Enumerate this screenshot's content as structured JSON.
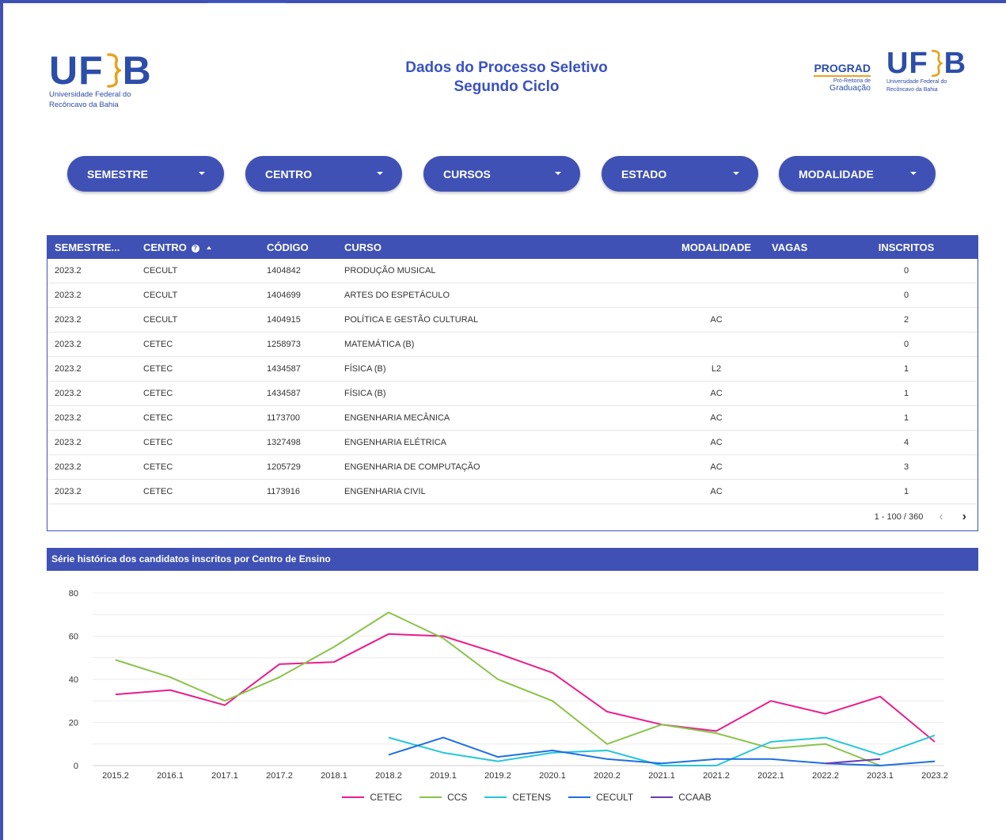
{
  "header": {
    "title_line1": "Dados do Processo Seletivo",
    "title_line2": "Segundo Ciclo",
    "logo_left": {
      "text_left": "UF",
      "text_right": "B",
      "sub1": "Universidade Federal do",
      "sub2": "Recôncavo da Bahia"
    },
    "logo_right": {
      "prograd": "PROGRAD",
      "prograd_sub1": "Pró-Reitoria de",
      "prograd_sub2": "Graduação",
      "text_left": "UF",
      "text_right": "B",
      "sub1": "Universidade Federal do",
      "sub2": "Recôncavo da Bahia"
    }
  },
  "filters": [
    "SEMESTRE",
    "CENTRO",
    "CURSOS",
    "ESTADO",
    "MODALIDADE"
  ],
  "table": {
    "headers": [
      "SEMESTRE...",
      "CENTRO",
      "CÓDIGO",
      "CURSO",
      "MODALIDADE",
      "VAGAS",
      "INSCRITOS"
    ],
    "help_icon": "?",
    "rows": [
      [
        "2023.2",
        "CECULT",
        "1404842",
        "PRODUÇÃO MUSICAL",
        "",
        "",
        "0"
      ],
      [
        "2023.2",
        "CECULT",
        "1404699",
        "ARTES DO ESPETÁCULO",
        "",
        "",
        "0"
      ],
      [
        "2023.2",
        "CECULT",
        "1404915",
        "POLÍTICA E GESTÃO CULTURAL",
        "AC",
        "",
        "2"
      ],
      [
        "2023.2",
        "CETEC",
        "1258973",
        "MATEMÁTICA (B)",
        "",
        "",
        "0"
      ],
      [
        "2023.2",
        "CETEC",
        "1434587",
        "FÍSICA (B)",
        "L2",
        "",
        "1"
      ],
      [
        "2023.2",
        "CETEC",
        "1434587",
        "FÍSICA (B)",
        "AC",
        "",
        "1"
      ],
      [
        "2023.2",
        "CETEC",
        "1173700",
        "ENGENHARIA MECÂNICA",
        "AC",
        "",
        "1"
      ],
      [
        "2023.2",
        "CETEC",
        "1327498",
        "ENGENHARIA ELÉTRICA",
        "AC",
        "",
        "4"
      ],
      [
        "2023.2",
        "CETEC",
        "1205729",
        "ENGENHARIA DE COMPUTAÇÃO",
        "AC",
        "",
        "3"
      ],
      [
        "2023.2",
        "CETEC",
        "1173916",
        "ENGENHARIA CIVIL",
        "AC",
        "",
        "1"
      ]
    ],
    "pagination": "1 - 100 / 360",
    "prev_glyph": "‹",
    "next_glyph": "›"
  },
  "chart_title": "Série histórica dos candidatos inscritos por Centro de Ensino",
  "chart_data": {
    "type": "line",
    "title": "Série histórica dos candidatos inscritos por Centro de Ensino",
    "categories": [
      "2015.2",
      "2016.1",
      "2017.1",
      "2017.2",
      "2018.1",
      "2018.2",
      "2019.1",
      "2019.2",
      "2020.1",
      "2020.2",
      "2021.1",
      "2021.2",
      "2022.1",
      "2022.2",
      "2023.1",
      "2023.2"
    ],
    "ylim": [
      0,
      80
    ],
    "yticks": [
      0,
      20,
      40,
      60,
      80
    ],
    "grid": true,
    "legend_position": "bottom",
    "series": [
      {
        "name": "CETEC",
        "color": "#e91e8c",
        "values": [
          33,
          35,
          28,
          47,
          48,
          61,
          60,
          52,
          43,
          25,
          19,
          16,
          30,
          24,
          32,
          11
        ]
      },
      {
        "name": "CCS",
        "color": "#8bc34a",
        "values": [
          49,
          41,
          30,
          41,
          55,
          71,
          59,
          40,
          30,
          10,
          19,
          15,
          8,
          10,
          0,
          null
        ]
      },
      {
        "name": "CETENS",
        "color": "#26c6da",
        "values": [
          null,
          null,
          null,
          null,
          null,
          13,
          6,
          2,
          6,
          7,
          0,
          0,
          11,
          13,
          5,
          14
        ]
      },
      {
        "name": "CECULT",
        "color": "#1e6fe0",
        "values": [
          null,
          null,
          null,
          null,
          null,
          5,
          13,
          4,
          7,
          3,
          1,
          3,
          3,
          1,
          0,
          2
        ]
      },
      {
        "name": "CCAAB",
        "color": "#673ab7",
        "values": [
          null,
          null,
          null,
          null,
          null,
          null,
          null,
          null,
          null,
          null,
          null,
          null,
          null,
          1,
          3,
          null
        ]
      }
    ]
  }
}
